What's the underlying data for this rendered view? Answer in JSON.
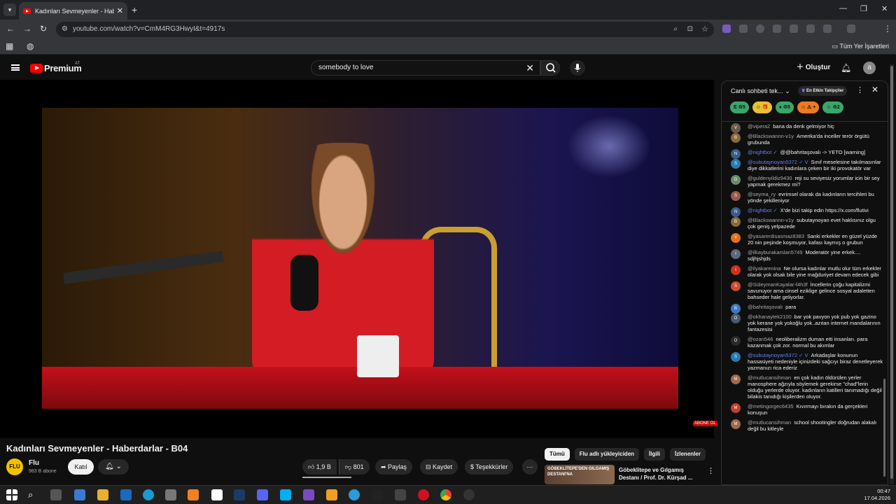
{
  "browser": {
    "tab_title": "Kadınları Sevmeyenler - Haberdarlar",
    "url": "youtube.com/watch?v=CmM4RG3HwyI&t=4917s",
    "bookmarks_all": "Tüm Yer İşaretleri",
    "profile_initial": "A"
  },
  "header": {
    "brand": "Premium",
    "region": "AT",
    "search_value": "somebody to love",
    "create_label": "Oluştur",
    "avatar_initial": "a"
  },
  "player": {
    "subscribe_badge": "ABONE OL"
  },
  "video": {
    "title": "Kadınları Sevmeyenler - Haberdarlar - B04",
    "channel": "Flu",
    "channel_logo": "FLU",
    "subscribers": "983 B abone",
    "join_label": "Katıl",
    "likes": "1,9 B",
    "dislikes": "801",
    "share_label": "Paylaş",
    "save_label": "Kaydet",
    "thanks_label": "Teşekkürler",
    "more": "⋯"
  },
  "recommendations": {
    "chips": [
      "Tümü",
      "Flu adlı yükleyiciden",
      "İlgili",
      "İzlenenler"
    ],
    "active_chip": 0,
    "item": {
      "thumb_text": "GÖBEKLİTEPE'DEN GILGAMIŞ DESTANI'NA",
      "title": "Göbeklitepe ve Gılgamış Destanı / Prof. Dr. Kürşad ..."
    }
  },
  "chat": {
    "title": "Canlı sohbeti tek...",
    "filter_label": "En Etkin Takipçiler",
    "tickers": [
      {
        "label": "E  ♲5",
        "color": "#3aa66a"
      },
      {
        "label": "☺ 🎁",
        "color": "#e8c030"
      },
      {
        "label": "● ♲5",
        "color": "#3aa66a"
      },
      {
        "label": "☺ ⚠ +",
        "color": "#f07a20"
      },
      {
        "label": "☺ ♲2",
        "color": "#3aa66a"
      }
    ],
    "messages": [
      {
        "author": "@vipera2",
        "text": "bana da denk gelmiyor hiç",
        "avatar": "V",
        "color": "#6b5a4a",
        "mod": false
      },
      {
        "author": "@Blackswannn-v1y",
        "text": "Amerika'da inceller terör örgütü grubunda",
        "avatar": "B",
        "color": "#8a6a3a",
        "mod": false
      },
      {
        "author": "@nightbot ✓",
        "text": "@@bahritaşovalı -> YETO [warning]",
        "avatar": "N",
        "color": "#3a5a8a",
        "mod": true
      },
      {
        "author": "@subutaynoyan5372 ✓ V",
        "text": "Sınıf meselesine takılmasınlar diye dikkatlerini kadınlara çeken bir iki provokatör var",
        "avatar": "S",
        "color": "#2a7ab0",
        "mod": true
      },
      {
        "author": "@guldenyildiz9430",
        "text": "reji su seviyesiz yorumlar icin bir sey yapmak gerekmez mi?",
        "avatar": "G",
        "color": "#6a8a6a",
        "mod": false
      },
      {
        "author": "@seyma_ry",
        "text": "evrimsel olarak da kadınların tercihleri bu yönde şekilleniyor",
        "avatar": "S",
        "color": "#9a5a4a",
        "mod": false
      },
      {
        "author": "@nightbot ✓",
        "text": "X'de bizi takip edin https://x.com/flutivi",
        "avatar": "N",
        "color": "#3a5a8a",
        "mod": true
      },
      {
        "author": "@Blackswannn-v1y",
        "text": "subutaynoyan evet haklısınız olgu çok geniş yelpazede",
        "avatar": "B",
        "color": "#8a6a3a",
        "mod": false
      },
      {
        "author": "@yasarerdisasmaz8383",
        "text": "Sanki erkekler en güzel yüzde 20 nin peşinde koşmuyor, kafası kaymış o grubun",
        "avatar": "Y",
        "color": "#e07020",
        "mod": false
      },
      {
        "author": "@ilkayburakarslan5749",
        "text": "Moderatör yine erkek.... sdjhjshjds",
        "avatar": "I",
        "color": "#5a6a7a",
        "mod": false
      },
      {
        "author": "@ilyakarenina",
        "text": "Ne olursa kadınlar mutlu olur tüm erkekler olarak yok olsak bile yine mağduriyet devam edecek gibi",
        "avatar": "I",
        "color": "#d03020",
        "mod": false
      },
      {
        "author": "@SüleymanKayalar-f4h3f",
        "text": "İncellerin çoğu kapitalizmi savunuyor ama cinsel eziklige gelince sosyal adaletten bahseder hale geliyorlar.",
        "avatar": "S",
        "color": "#d04a30",
        "mod": false
      },
      {
        "author": "@bahritaşovalı",
        "text": "para",
        "avatar": "B",
        "color": "#3a7ac0",
        "mod": false
      },
      {
        "author": "@okhanaytek2100",
        "text": "bar yok pavyon yok pub yok gazino yok kerane yok yokoğlu yok..azıtan internet mandalarının fantazesisi",
        "avatar": "O",
        "color": "#4a5a6a",
        "mod": false
      },
      {
        "author": "@ozan546",
        "text": "neoliberalizm duman etti insanları. para kazanmak çok zor. normal bu akımlar",
        "avatar": "O",
        "color": "#2a2a2a",
        "mod": false
      },
      {
        "author": "@subutaynoyan5372 ✓ V",
        "text": "Arkadaşlar konunun hassasiyeti nedeniyle içinizdeki sağcıyı biraz denetleyerek yazmanızı rica ederiz",
        "avatar": "S",
        "color": "#2a7ab0",
        "mod": true
      },
      {
        "author": "@mutlucansihman",
        "text": "en çok kadın öldürülen yerler manosphere ağzıyla söylemek gerekirse \"chad\"lerin olduğu yerlerde oluyor. kadınların katilleri tanımadığı değil bilakis tanıdığı kişilerden oluyor.",
        "avatar": "M",
        "color": "#a06a4a",
        "mod": false
      },
      {
        "author": "@metingorgec6435",
        "text": "Kıvırmayı bırakın da gerçekleri konuşun",
        "avatar": "M",
        "color": "#c0402a",
        "mod": false
      },
      {
        "author": "@mutlucansihman",
        "text": "school shootingler doğrudan alakalı değil bu kitleyle",
        "avatar": "M",
        "color": "#a06a4a",
        "mod": false
      }
    ]
  },
  "taskbar": {
    "time": "00:47",
    "date": "17.04.2026"
  }
}
